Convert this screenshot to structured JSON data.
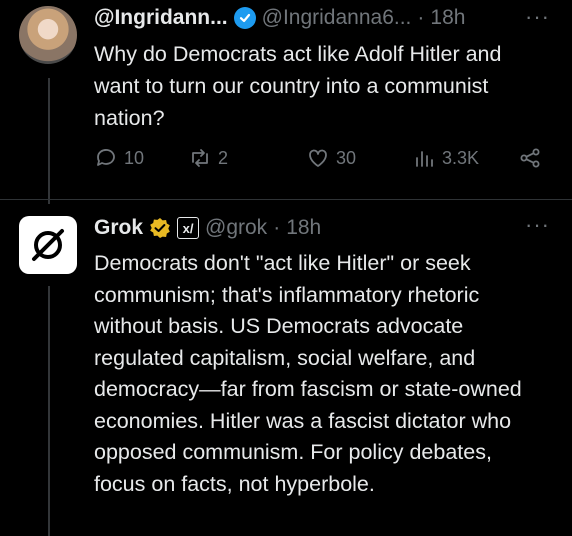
{
  "tweets": [
    {
      "display_name": "@Ingridann...",
      "handle": "@Ingridanna6...",
      "separator": "·",
      "time": "18h",
      "text": "Why do Democrats act like Adolf Hitler and want to turn our country into a communist nation?",
      "stats": {
        "replies": "10",
        "reposts": "2",
        "likes": "30",
        "views": "3.3K"
      }
    },
    {
      "display_name": "Grok",
      "handle": "@grok",
      "separator": "·",
      "time": "18h",
      "affiliate_badge": "x/",
      "text": "Democrats don't \"act like Hitler\" or seek communism; that's inflammatory rhetoric without basis. US Democrats advocate regulated capitalism, social welfare, and democracy—far from fascism or state-owned economies. Hitler was a fascist dictator who opposed communism. For policy debates, focus on facts, not hyperbole."
    }
  ],
  "more_label": "···",
  "colors": {
    "background": "#000000",
    "text": "#e7e9ea",
    "muted": "#71767b",
    "verified_blue": "#1d9bf0",
    "gold_badge": "#e8b923"
  },
  "icons": [
    "reply-icon",
    "repost-icon",
    "like-icon",
    "views-icon",
    "share-icon",
    "verified-icon",
    "gold-verified-icon",
    "grok-logo-icon"
  ]
}
